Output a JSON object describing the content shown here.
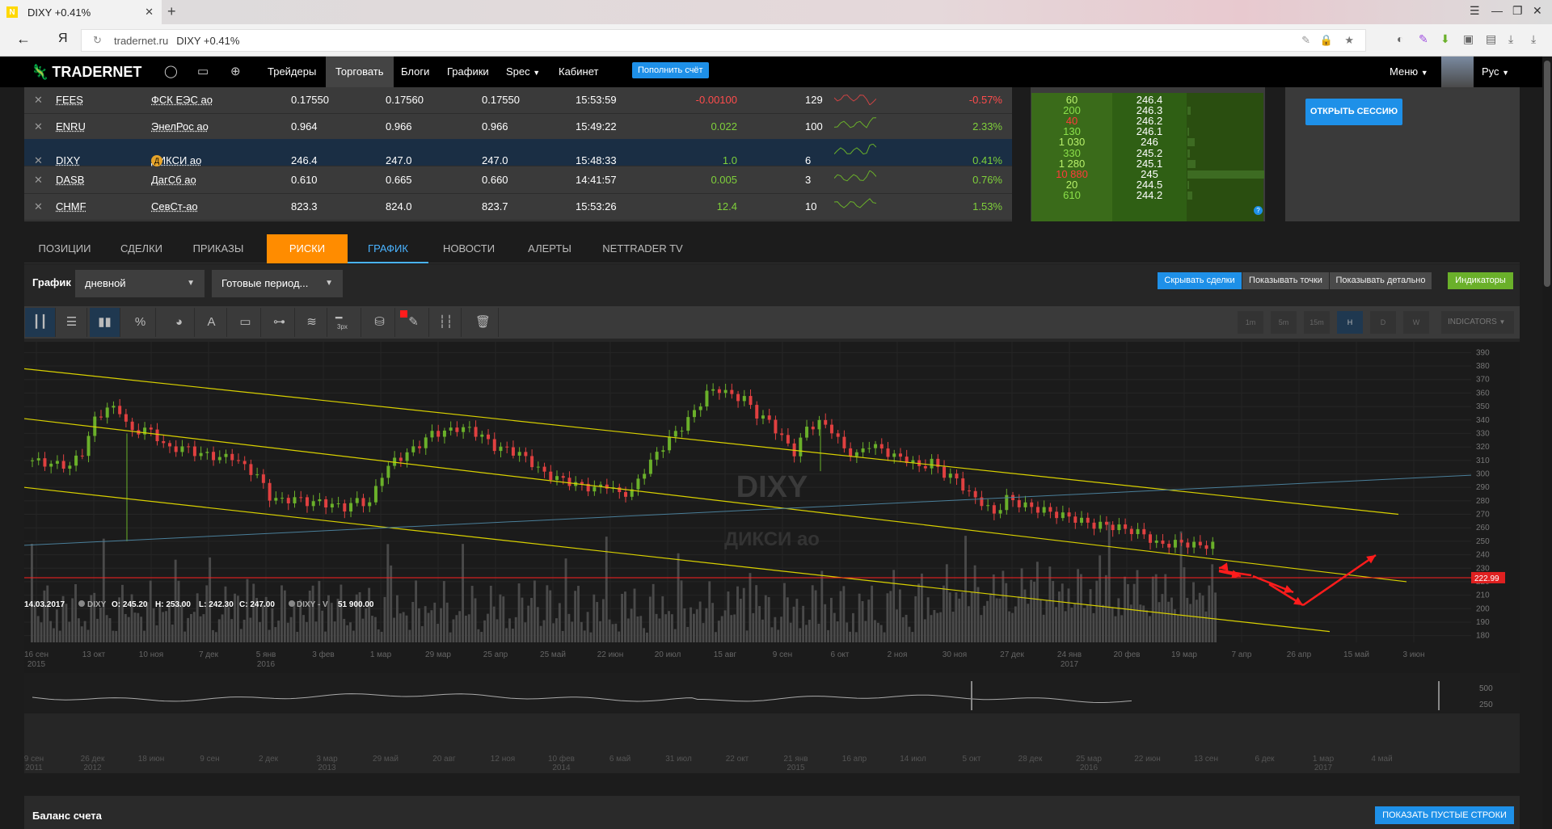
{
  "browser": {
    "tab_title": "DIXY +0.41%",
    "tab_favicon": "N",
    "url_domain": "tradernet.ru",
    "url_title": "DIXY +0.41%",
    "yandex": "Я"
  },
  "nav": {
    "logo": "TRADERNET",
    "items": [
      "Трейдеры",
      "Торговать",
      "Блоги",
      "Графики",
      "Spec",
      "Кабинет"
    ],
    "topup": "Пополнить счёт",
    "menu": "Меню",
    "lang": "Рус"
  },
  "quotes": {
    "rows": [
      {
        "ticker": "FEES",
        "name": "ФСК ЕЭС ао",
        "bid": "0.17550",
        "ask": "0.17560",
        "last": "0.17550",
        "time": "15:53:59",
        "chg": "-0.00100",
        "trades": "129",
        "pct": "-0.57%",
        "dir": "neg",
        "selected": false,
        "badge": false
      },
      {
        "ticker": "ENRU",
        "name": "ЭнелРос ао",
        "bid": "0.964",
        "ask": "0.966",
        "last": "0.966",
        "time": "15:49:22",
        "chg": "0.022",
        "trades": "100",
        "pct": "2.33%",
        "dir": "pos",
        "selected": false,
        "badge": false
      },
      {
        "ticker": "DIXY",
        "name": "ДИКСИ ао",
        "bid": "246.4",
        "ask": "247.0",
        "last": "247.0",
        "time": "15:48:33",
        "chg": "1.0",
        "trades": "6",
        "pct": "0.41%",
        "dir": "pos",
        "selected": true,
        "badge": true
      },
      {
        "ticker": "DASB",
        "name": "ДагСб ао",
        "bid": "0.610",
        "ask": "0.665",
        "last": "0.660",
        "time": "14:41:57",
        "chg": "0.005",
        "trades": "3",
        "pct": "0.76%",
        "dir": "pos",
        "selected": false,
        "badge": false
      },
      {
        "ticker": "CHMF",
        "name": "СевСт-ао",
        "bid": "823.3",
        "ask": "824.0",
        "last": "823.7",
        "time": "15:53:26",
        "chg": "12.4",
        "trades": "10",
        "pct": "1.53%",
        "dir": "pos",
        "selected": false,
        "badge": false
      }
    ]
  },
  "orderbook": {
    "rows": [
      {
        "qty": "60",
        "price": "246.4",
        "red": false
      },
      {
        "qty": "200",
        "price": "246.3",
        "red": false
      },
      {
        "qty": "40",
        "price": "246.2",
        "red": true
      },
      {
        "qty": "130",
        "price": "246.1",
        "red": false
      },
      {
        "qty": "1 030",
        "price": "246",
        "red": false
      },
      {
        "qty": "330",
        "price": "245.2",
        "red": false
      },
      {
        "qty": "1 280",
        "price": "245.1",
        "red": false
      },
      {
        "qty": "10 880",
        "price": "245",
        "red": true
      },
      {
        "qty": "20",
        "price": "244.5",
        "red": false
      },
      {
        "qty": "610",
        "price": "244.2",
        "red": false
      }
    ]
  },
  "session": {
    "open_label": "ОТКРЫТЬ СЕССИЮ"
  },
  "tabs": [
    "ПОЗИЦИИ",
    "СДЕЛКИ",
    "ПРИКАЗЫ",
    "РИСКИ",
    "ГРАФИК",
    "НОВОСТИ",
    "АЛЕРТЫ",
    "NETTRADER TV"
  ],
  "chart_panel": {
    "label": "График",
    "period": "дневной",
    "ready": "Готовые период...",
    "hide_deals": "Скрывать сделки",
    "show_points": "Показывать точки",
    "show_detail": "Показывать детально",
    "indicators": "Индикаторы",
    "intervals": [
      "1m",
      "5m",
      "15m",
      "H",
      "D",
      "W"
    ],
    "indicators_sel": "INDICATORS",
    "linewidth": "3px"
  },
  "chart_data": {
    "type": "candlestick",
    "watermark_ticker": "DIXY",
    "watermark_name": "ДИКСИ ао",
    "info": {
      "date": "14.03.2017",
      "sym": "DIXY",
      "o": "O: 245.20",
      "h": "H: 253.00",
      "l": "L: 242.30",
      "c": "C: 247.00",
      "vsym": "DIXY - V",
      "vol": "51 900.00"
    },
    "price_line": "222.99",
    "y_ticks": [
      "390",
      "380",
      "370",
      "360",
      "350",
      "340",
      "330",
      "320",
      "310",
      "300",
      "290",
      "280",
      "270",
      "260",
      "250",
      "240",
      "230",
      "220",
      "210",
      "200",
      "190",
      "180"
    ],
    "ylim": [
      175,
      395
    ],
    "x_ticks": [
      "16 сен 2015",
      "13 окт",
      "10 ноя",
      "7 дек",
      "5 янв 2016",
      "3 фев",
      "1 мар",
      "29 мар",
      "25 апр",
      "25 май",
      "22 июн",
      "20 июл",
      "15 авг",
      "9 сен",
      "6 окт",
      "2 ноя",
      "30 ноя",
      "27 дек",
      "24 янв 2017",
      "20 фев",
      "19 мар",
      "7 апр",
      "26 апр",
      "15 май",
      "3 июн"
    ],
    "x_tick_lines": [
      true,
      false,
      false,
      false,
      true,
      false,
      false,
      false,
      false,
      false,
      false,
      false,
      false,
      false,
      false,
      false,
      false,
      false,
      true,
      false,
      false,
      false,
      false,
      false,
      false
    ],
    "closes": [
      310,
      308,
      307,
      306,
      316,
      340,
      349,
      347,
      330,
      334,
      327,
      318,
      320,
      316,
      314,
      312,
      313,
      305,
      299,
      283,
      280,
      282,
      279,
      279,
      277,
      275,
      280,
      278,
      300,
      310,
      315,
      322,
      330,
      331,
      334,
      333,
      328,
      320,
      318,
      315,
      308,
      300,
      297,
      294,
      291,
      289,
      292,
      285,
      287,
      303,
      315,
      326,
      335,
      346,
      360,
      363,
      358,
      356,
      344,
      339,
      327,
      316,
      334,
      338,
      333,
      318,
      314,
      322,
      318,
      313,
      311,
      305,
      309,
      300,
      296,
      285,
      279,
      270,
      282,
      278,
      275,
      273,
      270,
      268,
      265,
      262,
      262,
      260,
      258,
      255,
      248,
      248,
      249,
      247,
      247
    ],
    "nav_ticks": [
      "9 сен 2011",
      "26 дек 2012",
      "18 июн",
      "9 сен",
      "2 дек",
      "3 мар 2013",
      "29 май",
      "20 авг",
      "12 ноя",
      "10 фев 2014",
      "6 май",
      "31 июл",
      "22 окт",
      "21 янв 2015",
      "16 апр",
      "14 июл",
      "5 окт",
      "28 дек",
      "25 мар 2016",
      "22 июн",
      "13 сен",
      "6 дек",
      "1 мар 2017",
      "4 май"
    ],
    "nav_scale": [
      "500",
      "250"
    ]
  },
  "balance": {
    "label": "Баланс счета",
    "show_empty": "ПОКАЗАТЬ ПУСТЫЕ СТРОКИ"
  },
  "colors": {
    "accent": "#1e90e8",
    "risk_tab": "#ff8c00",
    "pos": "#7fd03a",
    "neg": "#ff4c4c",
    "channel": "#e8e000",
    "arrow": "#ff1c1c",
    "trend": "#4a7f9a"
  }
}
